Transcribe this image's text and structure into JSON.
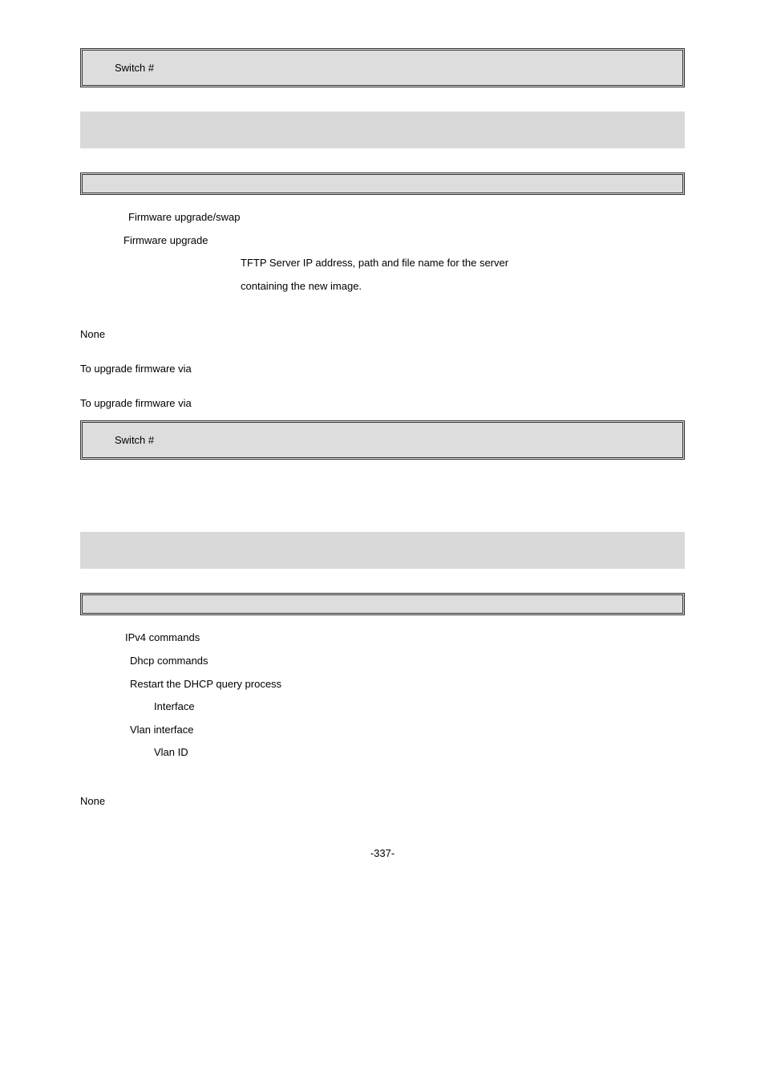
{
  "boxes": {
    "top_code": "Switch #",
    "mid_code": "Switch #"
  },
  "section1": {
    "param1": "Firmware upgrade/swap",
    "param2": "Firmware upgrade",
    "param3_line1": "TFTP Server IP address, path and file name for the server",
    "param3_line2": "containing the new image.",
    "none": "None",
    "usage1": "To upgrade firmware via",
    "usage2": "To upgrade firmware via"
  },
  "section2": {
    "p1": "IPv4 commands",
    "p2": "Dhcp commands",
    "p3": "Restart the DHCP query process",
    "p4": "Interface",
    "p5": "Vlan interface",
    "p6": "Vlan ID",
    "none": "None"
  },
  "footer": "-337-"
}
